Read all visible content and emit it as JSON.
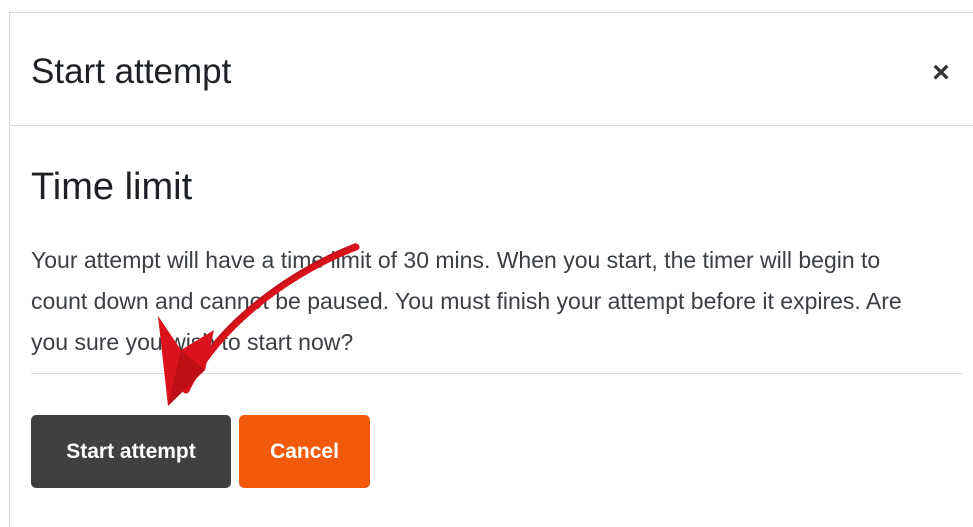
{
  "modal": {
    "title": "Start attempt",
    "close_symbol": "×",
    "close_icon": "close-icon"
  },
  "body": {
    "heading": "Time limit",
    "description": "Your attempt will have a time limit of 30 mins. When you start, the timer will begin to count down and cannot be paused. You must finish your attempt before it expires. Are you sure you wish to start now?"
  },
  "footer": {
    "start_label": "Start attempt",
    "cancel_label": "Cancel"
  },
  "colors": {
    "start_button": "#404040",
    "cancel_button": "#f15a0a",
    "arrow": "#d9121b"
  },
  "annotation": {
    "icon": "red-arrow-icon"
  }
}
